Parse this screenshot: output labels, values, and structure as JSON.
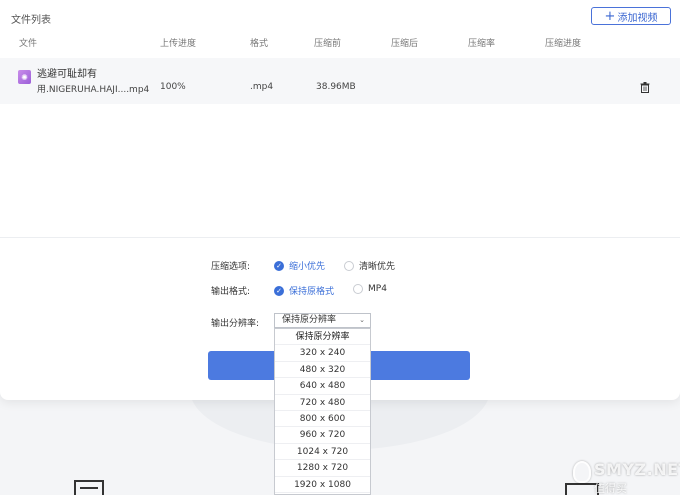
{
  "panel": {
    "title": "文件列表",
    "add_button": "添加视频"
  },
  "table": {
    "headers": [
      "文件",
      "上传进度",
      "格式",
      "压缩前",
      "压缩后",
      "压缩率",
      "压缩进度"
    ],
    "row": {
      "name": "逃避可耻却有",
      "path": "用.NIGERUHA.HAJI....mp4",
      "upload_progress": "100%",
      "format": ".mp4",
      "size_before": "38.96MB"
    }
  },
  "options": {
    "compress_label": "压缩选项:",
    "compress_opt1": "缩小优先",
    "compress_opt2": "清晰优先",
    "format_label": "输出格式:",
    "format_opt1": "保持原格式",
    "format_opt2": "MP4",
    "resolution_label": "输出分辨率:",
    "resolution_selected": "保持原分辨率"
  },
  "dropdown": {
    "items": [
      "保持原分辨率",
      "320 x 240",
      "480 x 320",
      "640 x 480",
      "720 x 480",
      "800 x 600",
      "960 x 720",
      "1024 x 720",
      "1280 x 720",
      "1920 x 1080"
    ]
  },
  "watermark": {
    "text": "SMYZ.NET",
    "sub": "值得买"
  },
  "colors": {
    "accent": "#3b6fd8",
    "button": "#4c7ae0"
  }
}
